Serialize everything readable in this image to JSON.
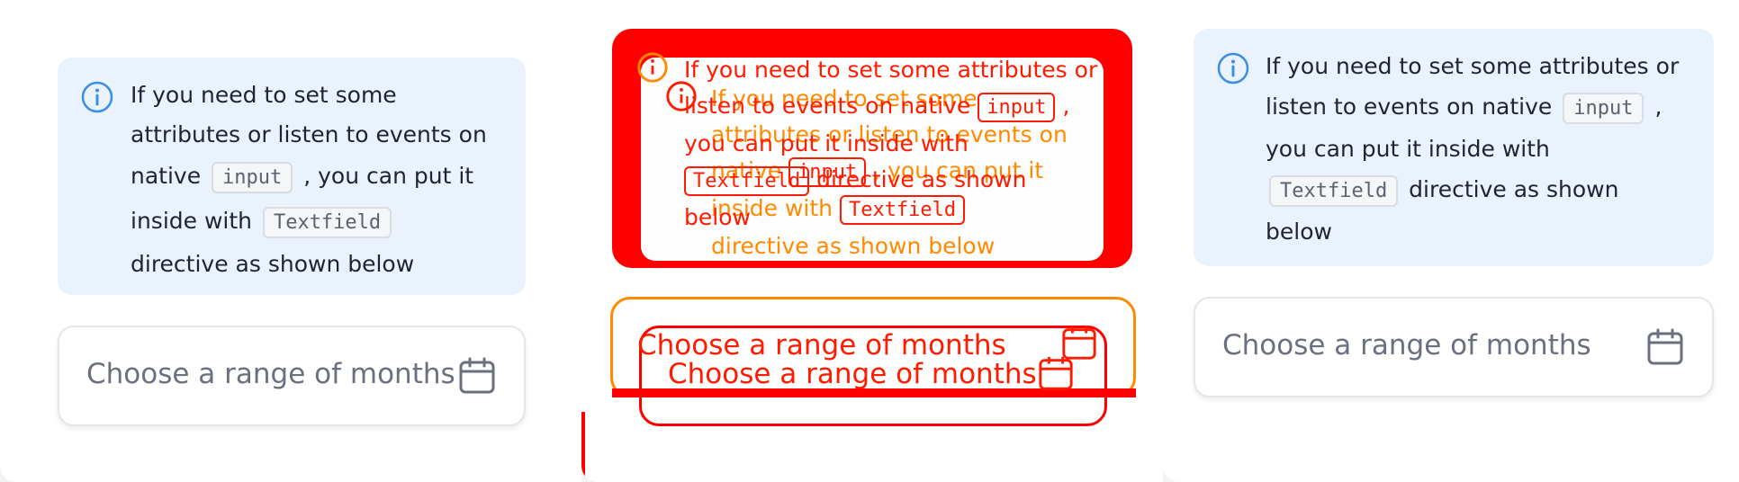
{
  "notice": {
    "line1": "If you need to set some",
    "line2": "attributes or listen to events on",
    "native_prefix": "native",
    "code_input": "input",
    "after_input": ", you can put it",
    "inside_with": "inside with",
    "code_textfield": "Textfield",
    "final_line": "directive as shown below",
    "wide_line1": "If you need to set some attributes or",
    "wide_line2_prefix": "listen to events on native",
    "wide_line2_suffix": ",",
    "wide_line3": "you can put it inside with",
    "wide_line4_suffix": "directive as shown",
    "wide_line5": "below"
  },
  "field": {
    "placeholder": "Choose a range of months",
    "icon": "calendar-icon"
  },
  "icons": {
    "info": "info-icon",
    "calendar": "calendar-icon"
  },
  "colors": {
    "callout_bg": "#eaf3fd",
    "info_blue": "#3b8ee8",
    "diff_red": "#ff0000",
    "diff_orange": "#ff8a00"
  }
}
